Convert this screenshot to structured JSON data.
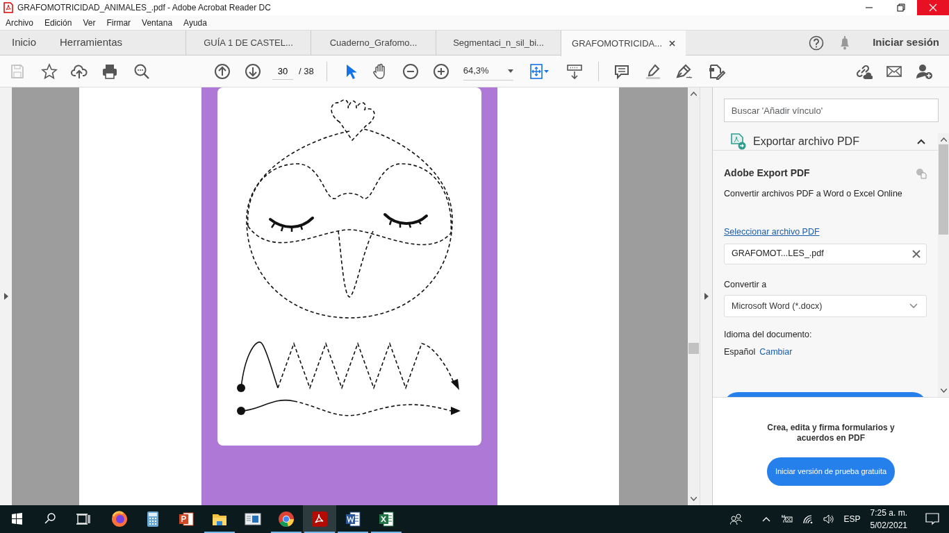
{
  "window": {
    "title": "GRAFOMOTRICIDAD_ANIMALES_.pdf - Adobe Acrobat Reader DC"
  },
  "menu": [
    "Archivo",
    "Edición",
    "Ver",
    "Firmar",
    "Ventana",
    "Ayuda"
  ],
  "home_tabs": [
    "Inicio",
    "Herramientas"
  ],
  "doc_tabs": [
    {
      "label": "GUÍA 1 DE CASTEL...",
      "selected": false
    },
    {
      "label": "Cuaderno_Grafomo...",
      "selected": false
    },
    {
      "label": "Segmentaci_n_sil_bi...",
      "selected": false
    },
    {
      "label": "GRAFOMOTRICIDA...",
      "selected": true
    }
  ],
  "sign_in": "Iniciar sesión",
  "toolbar": {
    "page": "30",
    "page_total": "/ 38",
    "zoom": "64,3%"
  },
  "panel": {
    "search": {
      "placeholder": "Buscar 'Añadir vínculo'"
    },
    "section": {
      "title": "Exportar archivo PDF",
      "expanded": true
    },
    "heading": "Adobe Export PDF",
    "description": "Convertir archivos PDF a Word o Excel Online",
    "select_link": "Seleccionar archivo PDF",
    "file": "GRAFOMOT...LES_.pdf",
    "convert_label": "Convertir a",
    "convert_value": "Microsoft Word (*.docx)",
    "language_label": "Idioma del documento:",
    "language_value": "Español",
    "change_link": "Cambiar",
    "promo": "Crea, edita y firma formularios y acuerdos en PDF",
    "trial_button": "Iniciar versión de prueba gratuita"
  },
  "taskbar": {
    "apps": [
      {
        "kind": "firefox",
        "running": false,
        "active": false
      },
      {
        "kind": "calculator",
        "running": false,
        "active": false
      },
      {
        "kind": "powerpoint",
        "running": false,
        "active": false
      },
      {
        "kind": "explorer",
        "running": true,
        "active": false
      },
      {
        "kind": "window",
        "running": false,
        "active": false
      },
      {
        "kind": "chrome",
        "running": true,
        "active": false
      },
      {
        "kind": "acrobat",
        "running": true,
        "active": true
      },
      {
        "kind": "word",
        "running": true,
        "active": false
      },
      {
        "kind": "excel",
        "running": true,
        "active": false
      }
    ],
    "language": "ESP",
    "time": "7:25 a. m.",
    "date": "5/02/2021"
  }
}
